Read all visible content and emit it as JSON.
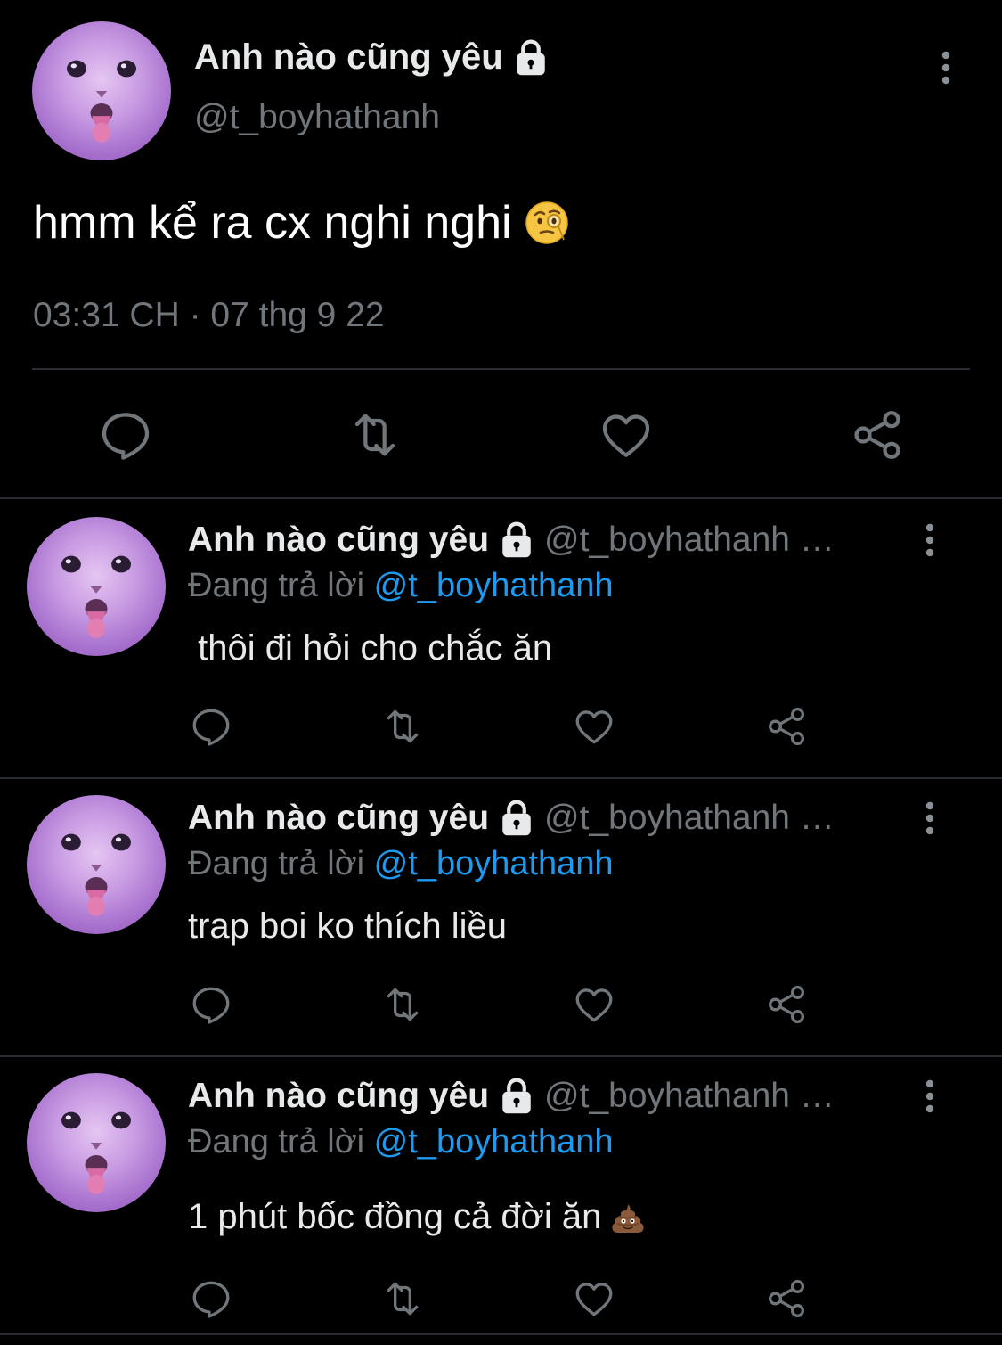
{
  "main_tweet": {
    "display_name": "Anh nào cũng yêu",
    "handle": "@t_boyhathanh",
    "text": "hmm kể ra cx nghi nghi",
    "emoji": "face-with-monocle",
    "timestamp": "03:31 CH · 07 thg 9 22",
    "icons": [
      "lock-icon",
      "more-vertical-icon",
      "reply-icon",
      "retweet-icon",
      "like-icon",
      "share-icon"
    ]
  },
  "replies": [
    {
      "display_name": "Anh nào cũng yêu",
      "handle": "@t_boyhathanh …",
      "replying_label": "Đang trả lời",
      "replying_to": "@t_boyhathanh",
      "text": " thôi đi hỏi cho chắc ăn",
      "emoji": ""
    },
    {
      "display_name": "Anh nào cũng yêu",
      "handle": "@t_boyhathanh …",
      "replying_label": "Đang trả lời",
      "replying_to": "@t_boyhathanh",
      "text": "trap boi ko thích liều",
      "emoji": ""
    },
    {
      "display_name": "Anh nào cũng yêu",
      "handle": "@t_boyhathanh …",
      "replying_label": "Đang trả lời",
      "replying_to": "@t_boyhathanh",
      "text": "1 phút bốc đồng cả đời ăn",
      "emoji": "pile-of-poo"
    }
  ],
  "colors": {
    "background": "#000000",
    "text_primary": "#e7e9ea",
    "text_secondary": "#71767b",
    "mention": "#1d9bf0",
    "divider": "#2a2d31",
    "icon": "#71767b",
    "avatar_tint": "#b27fd6"
  }
}
